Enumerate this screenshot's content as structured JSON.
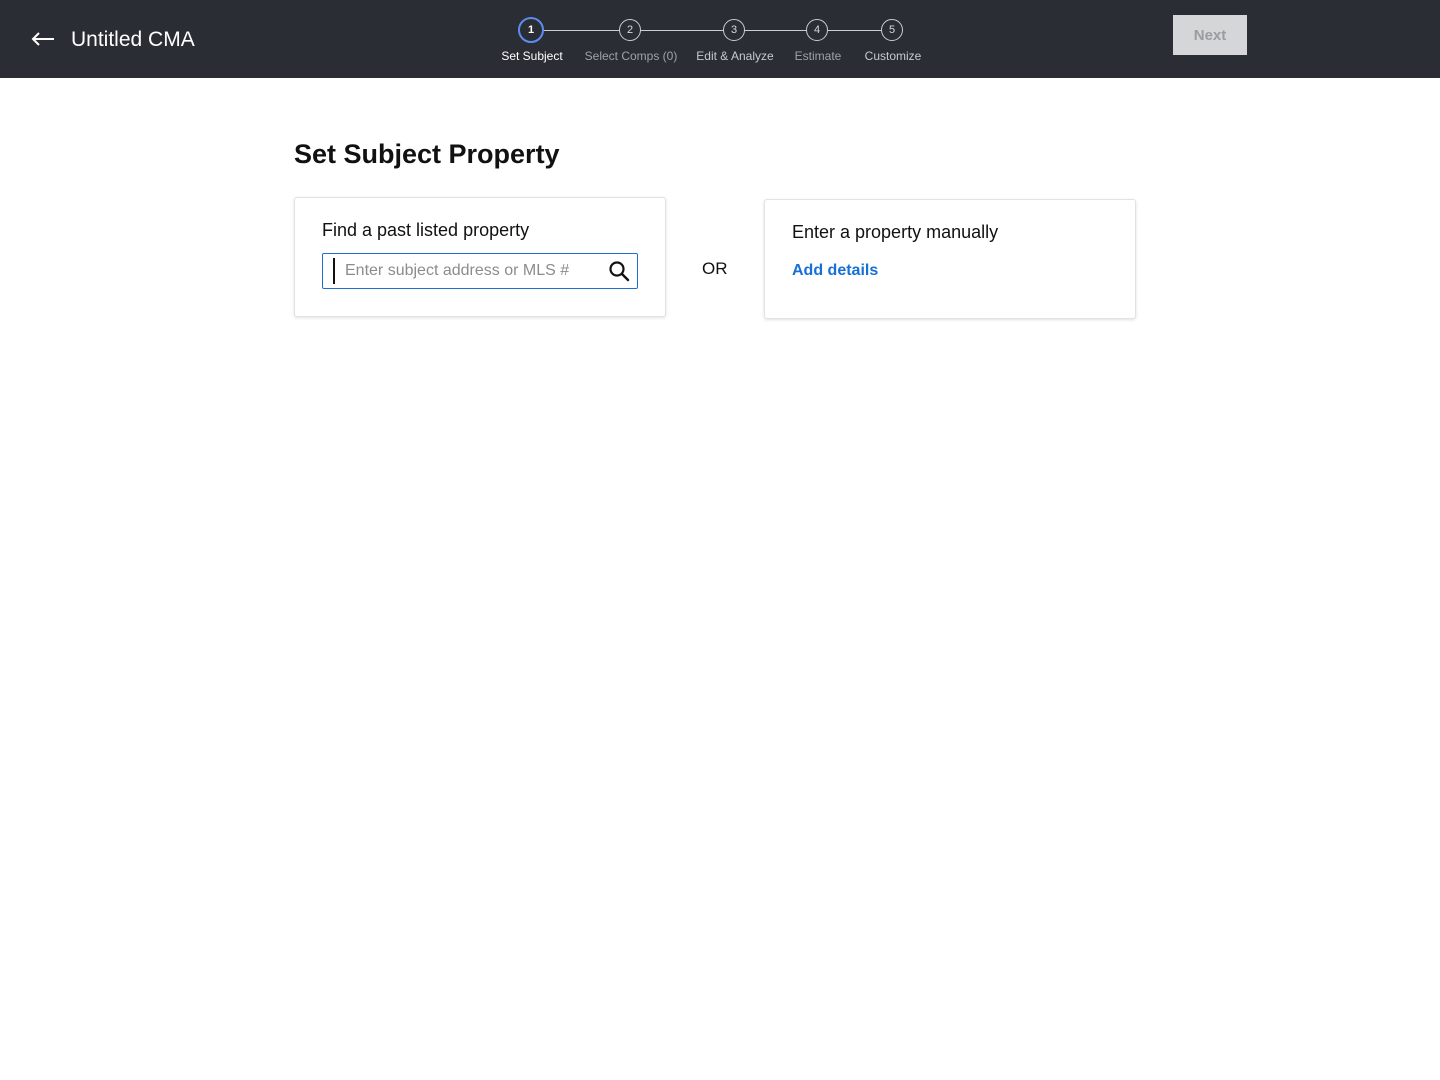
{
  "header": {
    "back_icon": "arrow-left-icon",
    "title": "Untitled CMA",
    "next_label": "Next",
    "next_enabled": false
  },
  "stepper": {
    "active_color": "#5b8df0",
    "steps": [
      {
        "number": "1",
        "label": "Set Subject",
        "state": "active"
      },
      {
        "number": "2",
        "label": "Select Comps (0)",
        "state": "inactive"
      },
      {
        "number": "3",
        "label": "Edit & Analyze",
        "state": "upcoming"
      },
      {
        "number": "4",
        "label": "Estimate",
        "state": "inactive"
      },
      {
        "number": "5",
        "label": "Customize",
        "state": "upcoming"
      }
    ]
  },
  "main": {
    "page_title": "Set Subject Property",
    "find_card": {
      "heading": "Find a past listed property",
      "search_placeholder": "Enter subject address or MLS #",
      "search_value": "",
      "search_icon": "search-icon"
    },
    "or_label": "OR",
    "manual_card": {
      "heading": "Enter a property manually",
      "link_label": "Add details",
      "link_color": "#1670d6"
    }
  }
}
